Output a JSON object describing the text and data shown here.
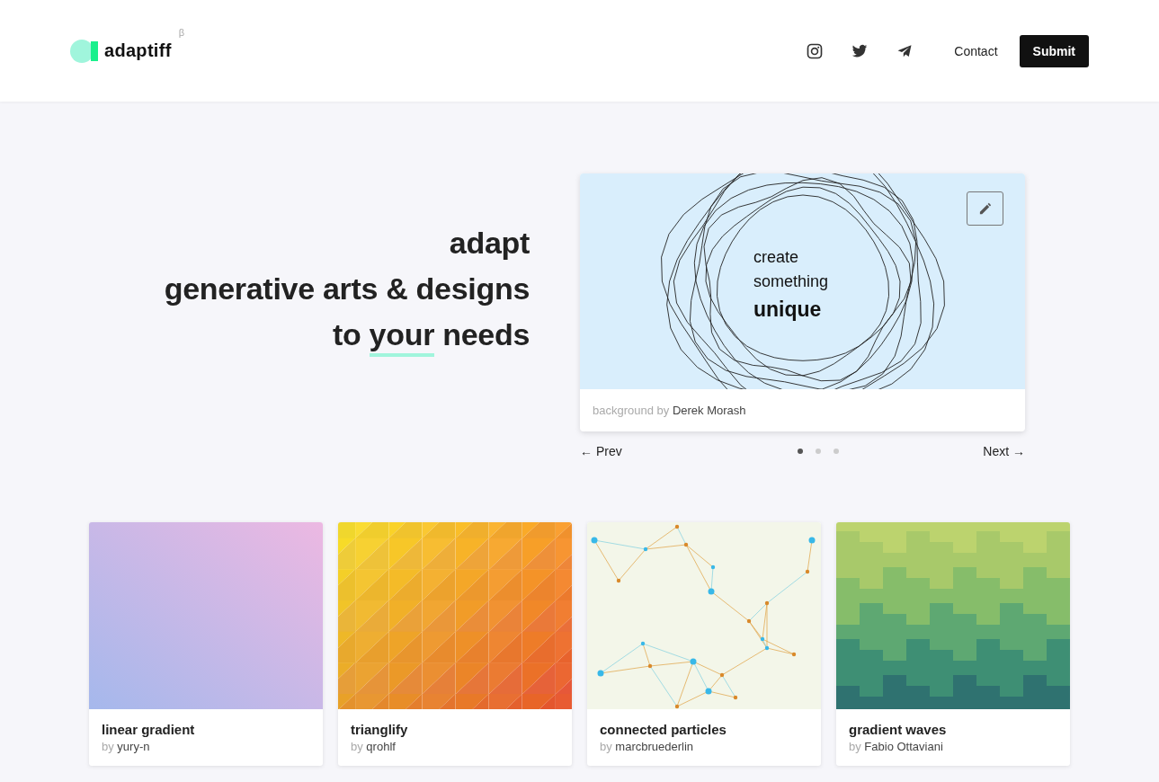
{
  "header": {
    "logo": {
      "text": "adaptiff",
      "badge": "β"
    },
    "social": [
      {
        "kind": "instagram"
      },
      {
        "kind": "twitter"
      },
      {
        "kind": "telegram"
      }
    ],
    "contact": "Contact",
    "submit": "Submit"
  },
  "hero": {
    "lines": [
      "adapt",
      "generative arts & designs"
    ],
    "last_line": {
      "before": "to ",
      "underlined": "your",
      "after": " needs"
    },
    "slide": {
      "art_lines": [
        "create",
        "something"
      ],
      "art_emphasis": "unique",
      "caption_label": "background by",
      "caption_author": "Derek Morash"
    },
    "prev": "← Prev",
    "next": "Next →",
    "dots": [
      {
        "selected": true
      },
      {
        "selected": false
      },
      {
        "selected": false
      }
    ]
  },
  "gallery": [
    {
      "kind": "gradient",
      "title": "linear gradient",
      "by": "by",
      "author": "yury-n"
    },
    {
      "kind": "triangles",
      "title": "trianglify",
      "by": "by",
      "author": "qrohlf"
    },
    {
      "kind": "particles",
      "title": "connected particles",
      "by": "by",
      "author": "marcbruederlin"
    },
    {
      "kind": "waves",
      "title": "gradient waves",
      "by": "by",
      "author": "Fabio Ottaviani"
    }
  ]
}
